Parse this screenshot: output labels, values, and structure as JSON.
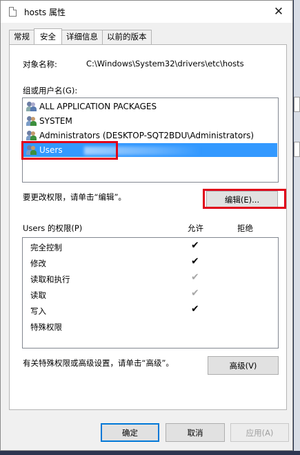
{
  "window": {
    "title": "hosts 属性",
    "close_glyph": "✕"
  },
  "tabs": [
    {
      "label": "常规",
      "active": false
    },
    {
      "label": "安全",
      "active": true
    },
    {
      "label": "详细信息",
      "active": false
    },
    {
      "label": "以前的版本",
      "active": false
    }
  ],
  "object": {
    "label": "对象名称:",
    "value": "C:\\Windows\\System32\\drivers\\etc\\hosts"
  },
  "groups": {
    "label": "组或用户名(G):",
    "items": [
      {
        "name": "ALL APPLICATION PACKAGES",
        "icon": "package-users-icon",
        "selected": false
      },
      {
        "name": "SYSTEM",
        "icon": "users-icon",
        "selected": false
      },
      {
        "name": "Administrators (DESKTOP-SQT2BDU\\Administrators)",
        "icon": "users-icon",
        "selected": false
      },
      {
        "name": "Users",
        "icon": "users-icon",
        "selected": true
      }
    ]
  },
  "edit": {
    "hint": "要更改权限，请单击“编辑”。",
    "button": "编辑(E)..."
  },
  "permissions": {
    "header": "Users 的权限(P)",
    "allow": "允许",
    "deny": "拒绝",
    "rows": [
      {
        "name": "完全控制",
        "allow": "✔",
        "inherited": false
      },
      {
        "name": "修改",
        "allow": "✔",
        "inherited": false
      },
      {
        "name": "读取和执行",
        "allow": "✔",
        "inherited": true
      },
      {
        "name": "读取",
        "allow": "✔",
        "inherited": true
      },
      {
        "name": "写入",
        "allow": "✔",
        "inherited": false
      },
      {
        "name": "特殊权限",
        "allow": "",
        "inherited": false
      }
    ]
  },
  "advanced": {
    "hint": "有关特殊权限或高级设置，请单击“高级”。",
    "button": "高级(V)"
  },
  "footer": {
    "ok": "确定",
    "cancel": "取消",
    "apply": "应用(A)"
  },
  "colors": {
    "selection": "#3399ff",
    "highlight_box": "#e0001a",
    "primary_border": "#0078d7"
  }
}
